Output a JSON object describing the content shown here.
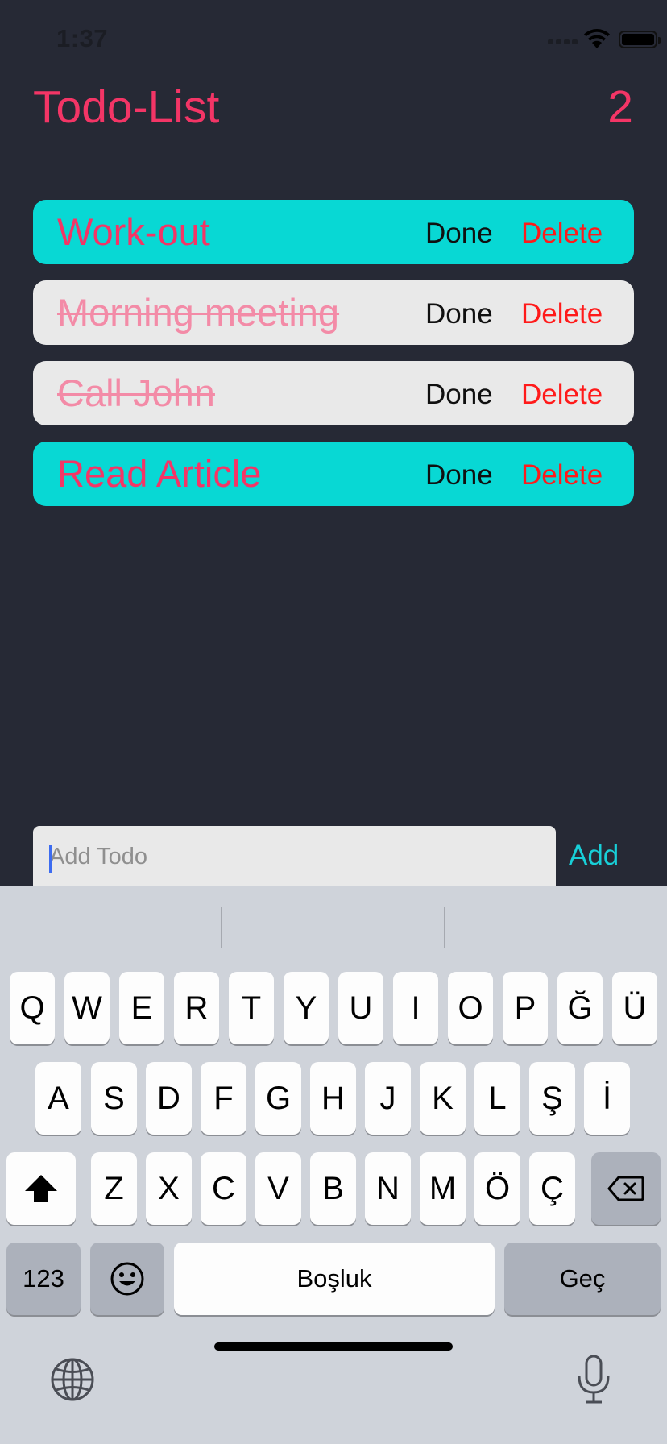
{
  "status_bar": {
    "time": "1:37"
  },
  "header": {
    "title": "Todo-List",
    "count": "2"
  },
  "todos": [
    {
      "text": "Work-out",
      "completed": false,
      "done_label": "Done",
      "delete_label": "Delete"
    },
    {
      "text": "Morning meeting",
      "completed": true,
      "done_label": "Done",
      "delete_label": "Delete"
    },
    {
      "text": "Call John",
      "completed": true,
      "done_label": "Done",
      "delete_label": "Delete"
    },
    {
      "text": "Read Article",
      "completed": false,
      "done_label": "Done",
      "delete_label": "Delete"
    }
  ],
  "input": {
    "placeholder": "Add Todo",
    "value": "",
    "add_label": "Add"
  },
  "keyboard": {
    "row1": [
      "Q",
      "W",
      "E",
      "R",
      "T",
      "Y",
      "U",
      "I",
      "O",
      "P",
      "Ğ",
      "Ü"
    ],
    "row2": [
      "A",
      "S",
      "D",
      "F",
      "G",
      "H",
      "J",
      "K",
      "L",
      "Ş",
      "İ"
    ],
    "row3": [
      "Z",
      "X",
      "C",
      "V",
      "B",
      "N",
      "M",
      "Ö",
      "Ç"
    ],
    "numbers_label": "123",
    "space_label": "Boşluk",
    "return_label": "Geç",
    "icons": [
      "shift-icon",
      "backspace-icon",
      "emoji-icon",
      "globe-icon",
      "microphone-icon"
    ]
  },
  "colors": {
    "background": "#262935",
    "accent": "#f33566",
    "active_item": "#08d8d4",
    "completed_item": "#e9e9e9",
    "delete": "#ff1a1a",
    "add": "#18cfd8"
  }
}
